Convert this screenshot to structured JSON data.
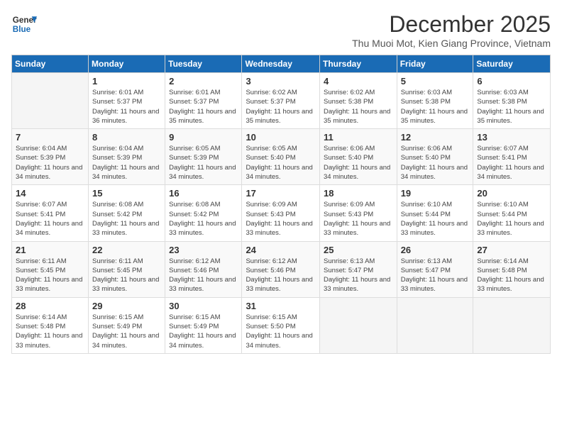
{
  "logo": {
    "line1": "General",
    "line2": "Blue"
  },
  "title": "December 2025",
  "subtitle": "Thu Muoi Mot, Kien Giang Province, Vietnam",
  "weekdays": [
    "Sunday",
    "Monday",
    "Tuesday",
    "Wednesday",
    "Thursday",
    "Friday",
    "Saturday"
  ],
  "weeks": [
    [
      {
        "day": "",
        "sunrise": "",
        "sunset": "",
        "daylight": ""
      },
      {
        "day": "1",
        "sunrise": "Sunrise: 6:01 AM",
        "sunset": "Sunset: 5:37 PM",
        "daylight": "Daylight: 11 hours and 36 minutes."
      },
      {
        "day": "2",
        "sunrise": "Sunrise: 6:01 AM",
        "sunset": "Sunset: 5:37 PM",
        "daylight": "Daylight: 11 hours and 35 minutes."
      },
      {
        "day": "3",
        "sunrise": "Sunrise: 6:02 AM",
        "sunset": "Sunset: 5:37 PM",
        "daylight": "Daylight: 11 hours and 35 minutes."
      },
      {
        "day": "4",
        "sunrise": "Sunrise: 6:02 AM",
        "sunset": "Sunset: 5:38 PM",
        "daylight": "Daylight: 11 hours and 35 minutes."
      },
      {
        "day": "5",
        "sunrise": "Sunrise: 6:03 AM",
        "sunset": "Sunset: 5:38 PM",
        "daylight": "Daylight: 11 hours and 35 minutes."
      },
      {
        "day": "6",
        "sunrise": "Sunrise: 6:03 AM",
        "sunset": "Sunset: 5:38 PM",
        "daylight": "Daylight: 11 hours and 35 minutes."
      }
    ],
    [
      {
        "day": "7",
        "sunrise": "Sunrise: 6:04 AM",
        "sunset": "Sunset: 5:39 PM",
        "daylight": "Daylight: 11 hours and 34 minutes."
      },
      {
        "day": "8",
        "sunrise": "Sunrise: 6:04 AM",
        "sunset": "Sunset: 5:39 PM",
        "daylight": "Daylight: 11 hours and 34 minutes."
      },
      {
        "day": "9",
        "sunrise": "Sunrise: 6:05 AM",
        "sunset": "Sunset: 5:39 PM",
        "daylight": "Daylight: 11 hours and 34 minutes."
      },
      {
        "day": "10",
        "sunrise": "Sunrise: 6:05 AM",
        "sunset": "Sunset: 5:40 PM",
        "daylight": "Daylight: 11 hours and 34 minutes."
      },
      {
        "day": "11",
        "sunrise": "Sunrise: 6:06 AM",
        "sunset": "Sunset: 5:40 PM",
        "daylight": "Daylight: 11 hours and 34 minutes."
      },
      {
        "day": "12",
        "sunrise": "Sunrise: 6:06 AM",
        "sunset": "Sunset: 5:40 PM",
        "daylight": "Daylight: 11 hours and 34 minutes."
      },
      {
        "day": "13",
        "sunrise": "Sunrise: 6:07 AM",
        "sunset": "Sunset: 5:41 PM",
        "daylight": "Daylight: 11 hours and 34 minutes."
      }
    ],
    [
      {
        "day": "14",
        "sunrise": "Sunrise: 6:07 AM",
        "sunset": "Sunset: 5:41 PM",
        "daylight": "Daylight: 11 hours and 34 minutes."
      },
      {
        "day": "15",
        "sunrise": "Sunrise: 6:08 AM",
        "sunset": "Sunset: 5:42 PM",
        "daylight": "Daylight: 11 hours and 33 minutes."
      },
      {
        "day": "16",
        "sunrise": "Sunrise: 6:08 AM",
        "sunset": "Sunset: 5:42 PM",
        "daylight": "Daylight: 11 hours and 33 minutes."
      },
      {
        "day": "17",
        "sunrise": "Sunrise: 6:09 AM",
        "sunset": "Sunset: 5:43 PM",
        "daylight": "Daylight: 11 hours and 33 minutes."
      },
      {
        "day": "18",
        "sunrise": "Sunrise: 6:09 AM",
        "sunset": "Sunset: 5:43 PM",
        "daylight": "Daylight: 11 hours and 33 minutes."
      },
      {
        "day": "19",
        "sunrise": "Sunrise: 6:10 AM",
        "sunset": "Sunset: 5:44 PM",
        "daylight": "Daylight: 11 hours and 33 minutes."
      },
      {
        "day": "20",
        "sunrise": "Sunrise: 6:10 AM",
        "sunset": "Sunset: 5:44 PM",
        "daylight": "Daylight: 11 hours and 33 minutes."
      }
    ],
    [
      {
        "day": "21",
        "sunrise": "Sunrise: 6:11 AM",
        "sunset": "Sunset: 5:45 PM",
        "daylight": "Daylight: 11 hours and 33 minutes."
      },
      {
        "day": "22",
        "sunrise": "Sunrise: 6:11 AM",
        "sunset": "Sunset: 5:45 PM",
        "daylight": "Daylight: 11 hours and 33 minutes."
      },
      {
        "day": "23",
        "sunrise": "Sunrise: 6:12 AM",
        "sunset": "Sunset: 5:46 PM",
        "daylight": "Daylight: 11 hours and 33 minutes."
      },
      {
        "day": "24",
        "sunrise": "Sunrise: 6:12 AM",
        "sunset": "Sunset: 5:46 PM",
        "daylight": "Daylight: 11 hours and 33 minutes."
      },
      {
        "day": "25",
        "sunrise": "Sunrise: 6:13 AM",
        "sunset": "Sunset: 5:47 PM",
        "daylight": "Daylight: 11 hours and 33 minutes."
      },
      {
        "day": "26",
        "sunrise": "Sunrise: 6:13 AM",
        "sunset": "Sunset: 5:47 PM",
        "daylight": "Daylight: 11 hours and 33 minutes."
      },
      {
        "day": "27",
        "sunrise": "Sunrise: 6:14 AM",
        "sunset": "Sunset: 5:48 PM",
        "daylight": "Daylight: 11 hours and 33 minutes."
      }
    ],
    [
      {
        "day": "28",
        "sunrise": "Sunrise: 6:14 AM",
        "sunset": "Sunset: 5:48 PM",
        "daylight": "Daylight: 11 hours and 33 minutes."
      },
      {
        "day": "29",
        "sunrise": "Sunrise: 6:15 AM",
        "sunset": "Sunset: 5:49 PM",
        "daylight": "Daylight: 11 hours and 34 minutes."
      },
      {
        "day": "30",
        "sunrise": "Sunrise: 6:15 AM",
        "sunset": "Sunset: 5:49 PM",
        "daylight": "Daylight: 11 hours and 34 minutes."
      },
      {
        "day": "31",
        "sunrise": "Sunrise: 6:15 AM",
        "sunset": "Sunset: 5:50 PM",
        "daylight": "Daylight: 11 hours and 34 minutes."
      },
      {
        "day": "",
        "sunrise": "",
        "sunset": "",
        "daylight": ""
      },
      {
        "day": "",
        "sunrise": "",
        "sunset": "",
        "daylight": ""
      },
      {
        "day": "",
        "sunrise": "",
        "sunset": "",
        "daylight": ""
      }
    ]
  ]
}
